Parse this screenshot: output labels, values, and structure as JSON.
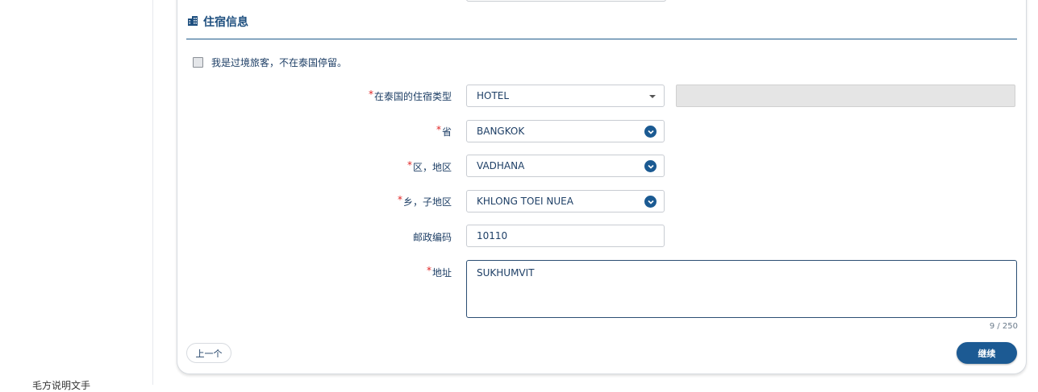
{
  "section": {
    "title": "住宿信息",
    "icon": "building-icon"
  },
  "transit": {
    "label": "我是过境旅客，不在泰国停留。",
    "checked": false
  },
  "form": {
    "accommodation_type": {
      "label": "在泰国的住宿类型",
      "value": "HOTEL",
      "required": true
    },
    "province": {
      "label": "省",
      "value": "BANGKOK",
      "required": true
    },
    "district": {
      "label": "区，地区",
      "value": "VADHANA",
      "required": true
    },
    "subdistrict": {
      "label": "乡，子地区",
      "value": "KHLONG TOEI NUEA",
      "required": true
    },
    "postal_code": {
      "label": "邮政编码",
      "value": "10110",
      "required": false
    },
    "address": {
      "label": "地址",
      "value": "SUKHUMVIT",
      "required": true,
      "counter": "9 / 250"
    }
  },
  "buttons": {
    "prev": "上一个",
    "next": "继续"
  },
  "sidebar": {
    "cut_text": "毛方说明文手"
  },
  "colors": {
    "accent": "#1c5a93",
    "required": "#e02424",
    "text": "#1e3f66"
  }
}
